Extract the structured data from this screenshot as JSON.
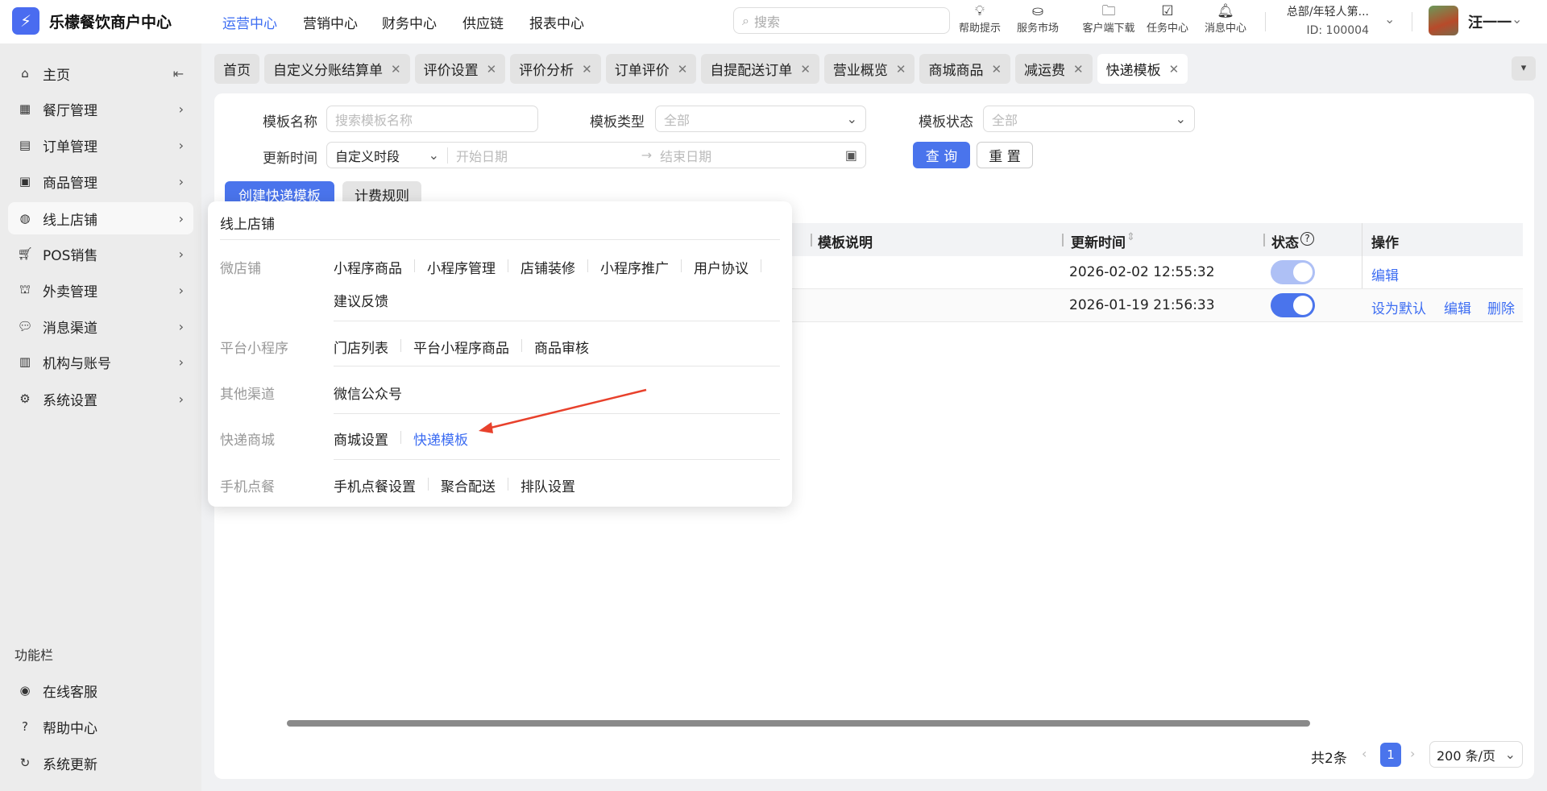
{
  "header": {
    "app_title": "乐檬餐饮商户中心",
    "nav": [
      "运营中心",
      "营销中心",
      "财务中心",
      "供应链",
      "报表中心"
    ],
    "nav_active": 0,
    "search_placeholder": "搜索",
    "tools": [
      {
        "label": "帮助提示",
        "icon": "lightbulb-icon"
      },
      {
        "label": "服务市场",
        "icon": "shopping-bag-icon"
      },
      {
        "label": "客户端下载",
        "icon": "folder-download-icon"
      },
      {
        "label": "任务中心",
        "icon": "clipboard-check-icon"
      },
      {
        "label": "消息中心",
        "icon": "bell-icon"
      }
    ],
    "org": "总部/年轻人第...",
    "org_id": "ID: 100004",
    "user": "汪一一"
  },
  "sidebar": {
    "items": [
      "主页",
      "餐厅管理",
      "订单管理",
      "商品管理",
      "线上店铺",
      "POS销售",
      "外卖管理",
      "消息渠道",
      "机构与账号",
      "系统设置"
    ],
    "active": 4,
    "footer_title": "功能栏",
    "footer_items": [
      "在线客服",
      "帮助中心",
      "系统更新"
    ]
  },
  "tabs": [
    {
      "label": "首页"
    },
    {
      "label": "自定义分账结算单"
    },
    {
      "label": "评价设置"
    },
    {
      "label": "评价分析"
    },
    {
      "label": "订单评价"
    },
    {
      "label": "自提配送订单"
    },
    {
      "label": "营业概览"
    },
    {
      "label": "商城商品"
    },
    {
      "label": "减运费"
    },
    {
      "label": "快递模板",
      "active": true
    }
  ],
  "filters": {
    "name_label": "模板名称",
    "name_placeholder": "搜索模板名称",
    "type_label": "模板类型",
    "type_value": "全部",
    "status_label": "模板状态",
    "status_value": "全部",
    "time_label": "更新时间",
    "time_mode": "自定义时段",
    "start_placeholder": "开始日期",
    "end_placeholder": "结束日期",
    "query": "查 询",
    "reset": "重 置"
  },
  "actions": {
    "create": "创建快递模板",
    "billing": "计费规则"
  },
  "table": {
    "columns": [
      "模板说明",
      "更新时间",
      "状态",
      "操作"
    ],
    "rows": [
      {
        "updated": "2026-02-02 12:55:32",
        "enabled": true,
        "disabled_toggle": true,
        "ops": [
          "编辑"
        ]
      },
      {
        "updated": "2026-01-19 21:56:33",
        "enabled": true,
        "disabled_toggle": false,
        "ops": [
          "设为默认",
          "编辑",
          "删除"
        ]
      }
    ]
  },
  "pagination": {
    "total": "共2条",
    "page": "1",
    "page_size": "200 条/页"
  },
  "popup": {
    "title": "线上店铺",
    "groups": [
      {
        "label": "微店铺",
        "items": [
          "小程序商品",
          "小程序管理",
          "店铺装修",
          "小程序推广",
          "用户协议"
        ],
        "items2": [
          "建议反馈"
        ]
      },
      {
        "label": "平台小程序",
        "items": [
          "门店列表",
          "平台小程序商品",
          "商品审核"
        ]
      },
      {
        "label": "其他渠道",
        "items": [
          "微信公众号"
        ]
      },
      {
        "label": "快递商城",
        "items": [
          "商城设置",
          "快递模板"
        ],
        "highlight": "快递模板"
      },
      {
        "label": "手机点餐",
        "items": [
          "手机点餐设置",
          "聚合配送",
          "排队设置"
        ]
      }
    ]
  },
  "colors": {
    "accent": "#3d6df2",
    "primary_button": "#4a74ec",
    "annotation_arrow": "#e8412c"
  }
}
